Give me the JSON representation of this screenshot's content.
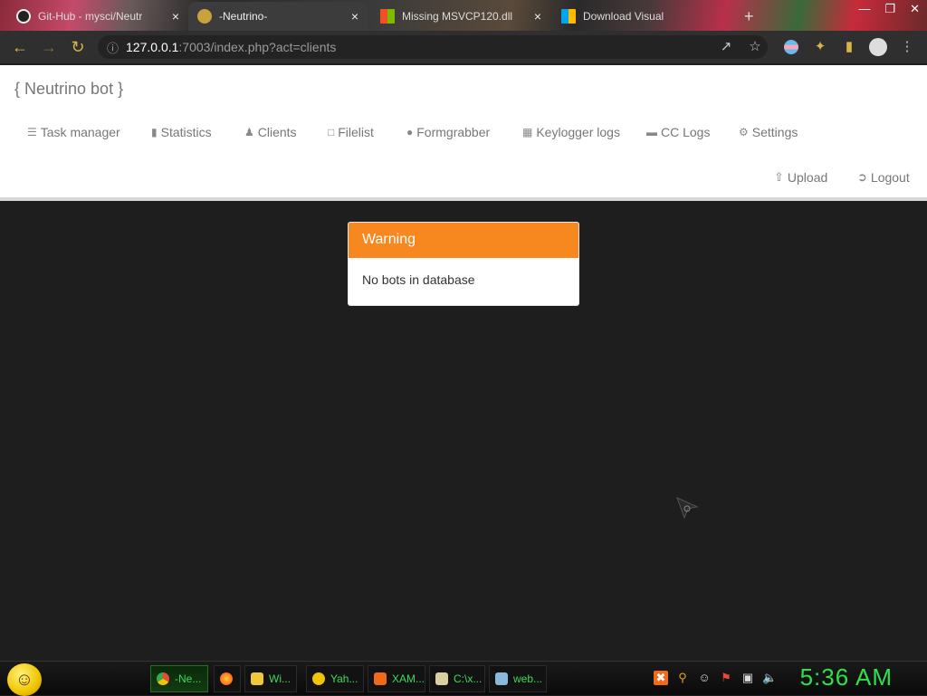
{
  "browser": {
    "tabs": [
      {
        "label": "Git-Hub - mysci/Neutr",
        "close": "×",
        "favicon": "github-icon"
      },
      {
        "label": "-Neutrino-",
        "close": "×",
        "favicon": "neutrino-icon",
        "active": true
      },
      {
        "label": "Missing MSVCP120.dll",
        "close": "×",
        "favicon": "microsoft-icon"
      },
      {
        "label": "Download Visual",
        "close": "",
        "favicon": "microsoft-icon"
      }
    ],
    "new_tab": "+",
    "window_controls": [
      "—",
      "❐",
      "✕"
    ],
    "address": {
      "host": "127.0.0.1",
      "rest": ":7003/index.php?act=clients"
    }
  },
  "app": {
    "brand": "{ Neutrino bot }",
    "menu": [
      {
        "label": "Task manager",
        "icon": "list-icon"
      },
      {
        "label": "Statistics",
        "icon": "bar-chart-icon"
      },
      {
        "label": "Clients",
        "icon": "user-icon"
      },
      {
        "label": "Filelist",
        "icon": "file-icon"
      },
      {
        "label": "Formgrabber",
        "icon": "globe-icon"
      },
      {
        "label": "Keylogger logs",
        "icon": "grid-icon"
      },
      {
        "label": "CC Logs",
        "icon": "credit-card-icon"
      },
      {
        "label": "Settings",
        "icon": "gear-icon"
      }
    ],
    "right_menu": [
      {
        "label": "Upload",
        "icon": "upload-icon"
      },
      {
        "label": "Logout",
        "icon": "logout-icon"
      }
    ],
    "warning": {
      "title": "Warning",
      "message": "No bots in database"
    }
  },
  "taskbar": {
    "items": [
      {
        "label": "-Ne...",
        "color": "#e84a3a"
      },
      {
        "label": "",
        "color": "#ff7a1a"
      },
      {
        "label": "Wi...",
        "color": "#f0c83a"
      },
      {
        "label": "Yah...",
        "color": "#f0c400"
      },
      {
        "label": "XAM...",
        "color": "#f06a1a"
      },
      {
        "label": "C:\\x...",
        "color": "#d8d0a0"
      },
      {
        "label": "web...",
        "color": "#8ab8d8"
      }
    ],
    "clock": "5:36 AM"
  },
  "colors": {
    "accent": "#f7881f",
    "address_accent": "#d8b64a",
    "taskbar_text": "#3fd85a"
  }
}
